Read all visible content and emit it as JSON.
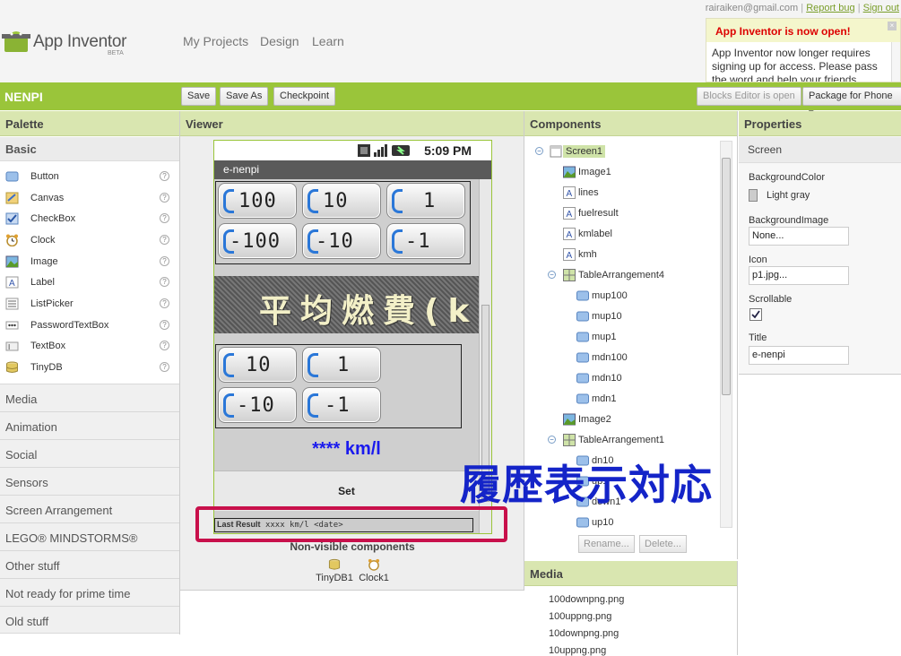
{
  "header": {
    "app_name": "App Inventor",
    "beta": "BETA",
    "nav": [
      "My Projects",
      "Design",
      "Learn"
    ],
    "user_email": "rairaiken@gmail.com",
    "links": [
      "Report bug",
      "Sign out"
    ]
  },
  "notice": {
    "title": "App Inventor is now open!",
    "body": "App Inventor now longer requires signing up for access. Please pass the word and help your friends"
  },
  "toolbar": {
    "project_name": "NENPI",
    "save": "Save",
    "save_as": "Save As",
    "checkpoint": "Checkpoint",
    "blocks_editor": "Blocks Editor is open",
    "package": "Package for Phone ▾"
  },
  "palette": {
    "title": "Palette",
    "basic": "Basic",
    "items": [
      "Button",
      "Canvas",
      "CheckBox",
      "Clock",
      "Image",
      "Label",
      "ListPicker",
      "PasswordTextBox",
      "TextBox",
      "TinyDB"
    ],
    "categories": [
      "Media",
      "Animation",
      "Social",
      "Sensors",
      "Screen Arrangement",
      "LEGO® MINDSTORMS®",
      "Other stuff",
      "Not ready for prime time",
      "Old stuff"
    ]
  },
  "viewer": {
    "title": "Viewer",
    "time": "5:09 PM",
    "screen_title": "e-nenpi",
    "buttons_row1": [
      "100",
      "10",
      "1"
    ],
    "buttons_row2": [
      "-100",
      "-10",
      "-1"
    ],
    "banner": "平均燃費(k",
    "buttons_row3": [
      "10",
      "1"
    ],
    "buttons_row4": [
      "-10",
      "-1"
    ],
    "kml": "**** km/l",
    "set": "Set",
    "last_result_label": "Last Result",
    "last_result_value": "xxxx km/l <date>",
    "nonvisible_title": "Non-visible components",
    "nonvisible": [
      "TinyDB1",
      "Clock1"
    ]
  },
  "components": {
    "title": "Components",
    "tree": [
      {
        "label": "Screen1",
        "level": 0,
        "toggle": "⊟",
        "selected": true
      },
      {
        "label": "Image1",
        "level": 1
      },
      {
        "label": "lines",
        "level": 1
      },
      {
        "label": "fuelresult",
        "level": 1
      },
      {
        "label": "kmlabel",
        "level": 1
      },
      {
        "label": "kmh",
        "level": 1
      },
      {
        "label": "TableArrangement4",
        "level": 1,
        "toggle": "⊟"
      },
      {
        "label": "mup100",
        "level": 2
      },
      {
        "label": "mup10",
        "level": 2
      },
      {
        "label": "mup1",
        "level": 2
      },
      {
        "label": "mdn100",
        "level": 2
      },
      {
        "label": "mdn10",
        "level": 2
      },
      {
        "label": "mdn1",
        "level": 2
      },
      {
        "label": "Image2",
        "level": 1
      },
      {
        "label": "TableArrangement1",
        "level": 1,
        "toggle": "⊟"
      },
      {
        "label": "dn10",
        "level": 2
      },
      {
        "label": "up1",
        "level": 2
      },
      {
        "label": "down1",
        "level": 2
      },
      {
        "label": "up10",
        "level": 2
      }
    ],
    "rename": "Rename...",
    "delete": "Delete..."
  },
  "overlay_text": "履歴表示対応",
  "media": {
    "title": "Media",
    "files": [
      "100downpng.png",
      "100uppng.png",
      "10downpng.png",
      "10uppng.png"
    ]
  },
  "properties": {
    "title": "Properties",
    "component": "Screen",
    "background_color_label": "BackgroundColor",
    "background_color_value": "Light gray",
    "background_image_label": "BackgroundImage",
    "background_image_value": "None...",
    "icon_label": "Icon",
    "icon_value": "p1.jpg...",
    "scrollable_label": "Scrollable",
    "title_label": "Title",
    "title_value": "e-nenpi"
  }
}
